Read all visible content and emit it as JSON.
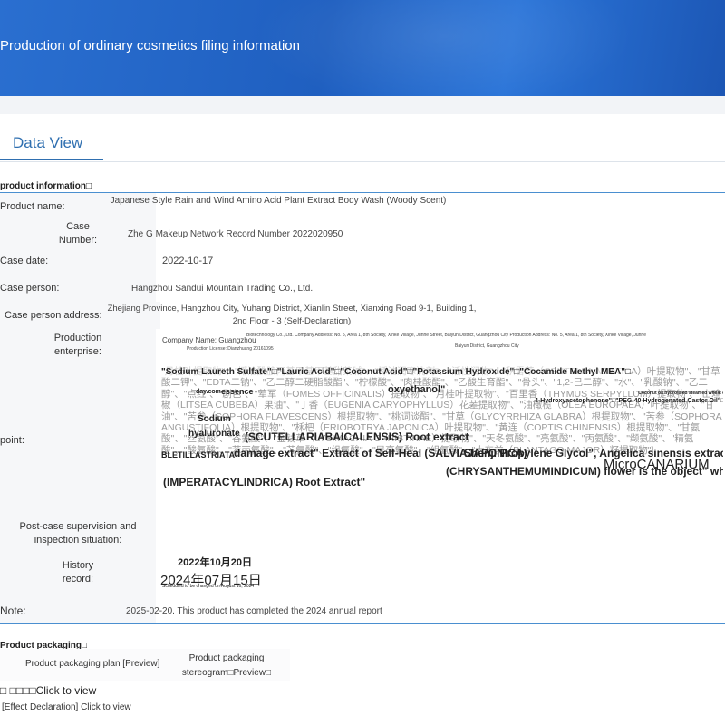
{
  "banner": {
    "title": "Production of ordinary cosmetics filing information"
  },
  "tabs": {
    "data_view": "Data View"
  },
  "sections": {
    "product_info": "product information□",
    "product_packaging": "Product packaging□"
  },
  "product": {
    "name_label": "Product name:",
    "name_value": "Japanese Style Rain and Wind Amino Acid Plant Extract Body Wash (Woody Scent)",
    "case_number_label": "Case Number:",
    "case_number_value": "Zhe G Makeup Network Record Number 2022020950",
    "case_date_label": "Case date:",
    "case_date_value": "2022-10-17",
    "case_person_label": "Case person:",
    "case_person_value": "Hangzhou Sandui Mountain Trading Co., Ltd.",
    "case_address_label": "Case person address:",
    "case_address_value": "Zhejiang Province, Hangzhou City, Yuhang District, Xianlin Street, Xianxing Road 9-1, Building 1, 2nd Floor - 3 (Self-Declaration)",
    "enterprise_label": "Production enterprise:",
    "enterprise_company": "Company Name: Guangzhou",
    "enterprise_detail": "Biotechnology Co., Ltd. Company Address: No. 5, Area 1, 8th Society, Xinke Village, Junhe Street, Baiyun District, Guangzhou City Production Address: No. 5, Area 1, 8th Society, Xinke Village, Junhe",
    "enterprise_license": "Production License: Dianzhuang 20161095",
    "enterprise_tail": "Baiyun District, Guangzhou City",
    "point_label": "point:",
    "supervision_label": "Post-case supervision and inspection situation:",
    "history_label": "History record:",
    "history_entry_1": "2022年10月20日",
    "history_entry_2": "2024年07月15日",
    "history_note": "Scheduled to be changed on August 16, 2024",
    "note_label": "Note:",
    "note_value": "2025-02-20. This product has completed the 2024 annual report"
  },
  "ingredients": {
    "background_text": "\"月桂叶提取物\"、\"椰油酰胺丙基甲基甲基甜菜碱\"、\"椰油润寒洗剂\"、\"活性润物\"、\"积雪草（CENTELLA ASIATICA）叶提取物\"、\"甘草酸二钾\"、\"EDTA二钠\"、\"乙二醇二硬脂酸酯\"、\"柠檬酸\"、\"肉桂酸酯\"、\"乙酸生育酯\"、\"骨头\"、\"1,2-己二醇\"、\"水\"、\"乳酸钠\"、\"乙二醇\"、\"点红\"、\"剧色\"、\"荤军（FOMES OFFICINALIS）提取物\"、\"月桂叶提取物\"、\"百里香（THYMUS SERPYLLUM）提取物\"、\"山鸡椒（LITSEA CUBEBA）果油\"、\"丁香（EUGENIA CARYOPHYLLUS）花蒫提取物\"、\"油橄榄（OLEA EUROPAEA）叶提取物\"、\"甘油\"、\"苦参（SOPHORA FLAVESCENS）根提取物\"、\"桃词谈酯\"、\"甘草（GLYCYRRHIZA GLABRA）根提取物\"、\"苦参（SOPHORA ANGUSTIFOLIA）根提取物\"、\"柇杷（ERIOBOTRYA JAPONICA）叶提取物\"、\"黄连（COPTIS CHINENSIS）根提取物\"、\"甘氨酸\"、\"丝氨酸\"、\"谷氨酸\"、\"金钱草（LYSIMACHIA CHRISTINAE）提取物\"、\"天冬氨酸\"、\"亮氨酸\"、\"丙氨酸\"、\"缬氨酸\"、\"精氨酸\"、\"酸氨酸\"、\"苯丙氨酸\"、\"苏氨酸\"、\"组氨酸\"、\"异亮氨酸\"、\"组氨酸\"、\"大车前（PLANTAGO MAJOR）籽提取物\"]",
    "overlays": [
      "\"Sodium Laureth Sulfate\"□\"Lauric Acid\"□\"Coconut Acid\"□\"Potassium Hydroxide\"□\"Cocamide Methyl MEA\"□",
      "day.com",
      "essence",
      "oxyethanol\"",
      "\"Coconut oil hydrolised steamed wheat egg",
      "4-Hydroxyacetophenone\"□\"PEG-40 Hydrogenated Castor Oil\"□",
      "Sodium",
      "hyaluronate",
      "(SCUTELLARIABAICALENSIS) Root extract",
      "BLETILLASTRIATA",
      "damage extract\" Extract of Self-Heal (SALVIAJAPONICA)",
      "Shenji Propylene Glycol\", Angelica sinensis extract",
      "MicroCANARIUM",
      "(CHRYSANTHEMUMINDICUM) flower is the object\" white",
      "(IMPERATACYLINDRICA) Root Extract\""
    ]
  },
  "packaging": {
    "plan_label": "Product packaging plan [Preview]",
    "stereogram_label": "Product packaging stereogram□Preview□",
    "click_view": "□ □□□□Click to view",
    "effect_declaration": "[Effect Declaration] Click to view"
  }
}
